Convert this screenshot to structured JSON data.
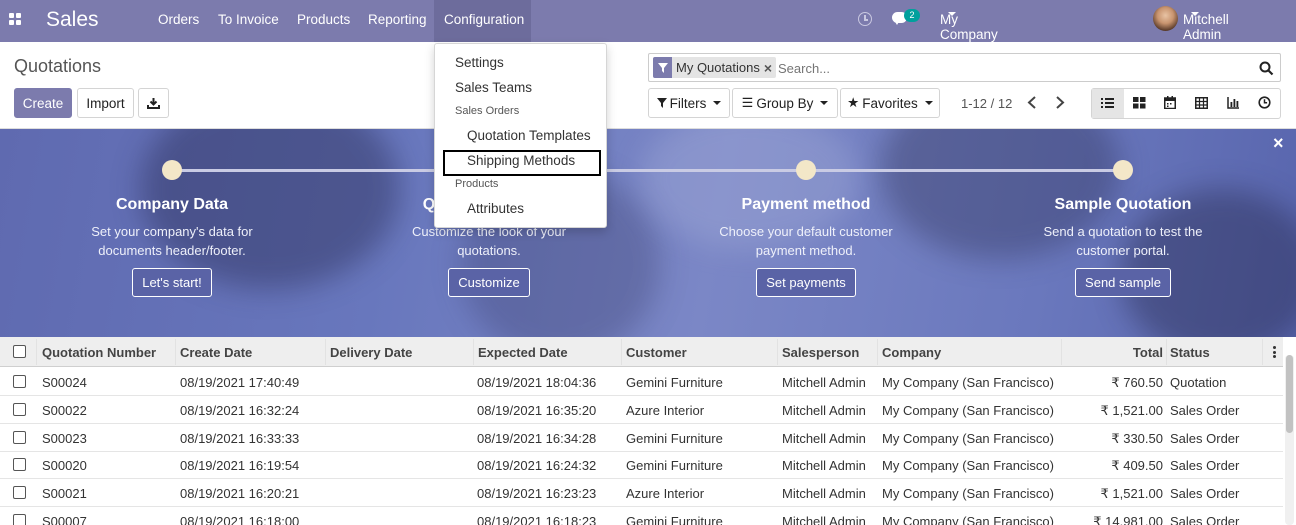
{
  "app": {
    "name": "Sales"
  },
  "menu": [
    "Orders",
    "To Invoice",
    "Products",
    "Reporting",
    "Configuration"
  ],
  "systray": {
    "message_count": "2",
    "company": "My Company (San Francisco)",
    "user": "Mitchell Admin"
  },
  "page": {
    "title": "Quotations",
    "create_label": "Create",
    "import_label": "Import"
  },
  "search": {
    "facet": "My Quotations",
    "placeholder": "Search..."
  },
  "toolbar": {
    "filters": "Filters",
    "group_by": "Group By",
    "favorites": "Favorites",
    "pager": "1-12 / 12"
  },
  "config_menu": {
    "items": [
      {
        "label": "Settings"
      },
      {
        "label": "Sales Teams"
      },
      {
        "label": "Sales Orders",
        "header": true
      },
      {
        "label": "Quotation Templates"
      },
      {
        "label": "Shipping Methods",
        "highlighted": true
      },
      {
        "label": "Products",
        "header": true
      },
      {
        "label": "Attributes"
      }
    ]
  },
  "onboarding": {
    "steps": [
      {
        "title": "Company Data",
        "desc1": "Set your company's data for",
        "desc2": "documents header/footer.",
        "button": "Let's start!"
      },
      {
        "title": "Quotation Layout",
        "desc1": "Customize the look of your",
        "desc2": "quotations.",
        "button": "Customize"
      },
      {
        "title": "Payment method",
        "desc1": "Choose your default customer",
        "desc2": "payment method.",
        "button": "Set payments"
      },
      {
        "title": "Sample Quotation",
        "desc1": "Send a quotation to test the",
        "desc2": "customer portal.",
        "button": "Send sample"
      }
    ],
    "close": "×"
  },
  "table": {
    "columns": [
      "Quotation Number",
      "Create Date",
      "Delivery Date",
      "Expected Date",
      "Customer",
      "Salesperson",
      "Company",
      "Total",
      "Status"
    ],
    "rows": [
      {
        "number": "S00024",
        "create": "08/19/2021 17:40:49",
        "delivery": "",
        "expected": "08/19/2021 18:04:36",
        "customer": "Gemini Furniture",
        "salesperson": "Mitchell Admin",
        "company": "My Company (San Francisco)",
        "total": "₹ 760.50",
        "status": "Quotation"
      },
      {
        "number": "S00022",
        "create": "08/19/2021 16:32:24",
        "delivery": "",
        "expected": "08/19/2021 16:35:20",
        "customer": "Azure Interior",
        "salesperson": "Mitchell Admin",
        "company": "My Company (San Francisco)",
        "total": "₹ 1,521.00",
        "status": "Sales Order"
      },
      {
        "number": "S00023",
        "create": "08/19/2021 16:33:33",
        "delivery": "",
        "expected": "08/19/2021 16:34:28",
        "customer": "Gemini Furniture",
        "salesperson": "Mitchell Admin",
        "company": "My Company (San Francisco)",
        "total": "₹ 330.50",
        "status": "Sales Order"
      },
      {
        "number": "S00020",
        "create": "08/19/2021 16:19:54",
        "delivery": "",
        "expected": "08/19/2021 16:24:32",
        "customer": "Gemini Furniture",
        "salesperson": "Mitchell Admin",
        "company": "My Company (San Francisco)",
        "total": "₹ 409.50",
        "status": "Sales Order"
      },
      {
        "number": "S00021",
        "create": "08/19/2021 16:20:21",
        "delivery": "",
        "expected": "08/19/2021 16:23:23",
        "customer": "Azure Interior",
        "salesperson": "Mitchell Admin",
        "company": "My Company (San Francisco)",
        "total": "₹ 1,521.00",
        "status": "Sales Order"
      },
      {
        "number": "S00007",
        "create": "08/19/2021 16:18:00",
        "delivery": "",
        "expected": "08/19/2021 16:18:23",
        "customer": "Gemini Furniture",
        "salesperson": "Mitchell Admin",
        "company": "My Company (San Francisco)",
        "total": "₹ 14,981.00",
        "status": "Sales Order"
      }
    ]
  },
  "colors": {
    "brand": "#7c7bad",
    "banner": "#6a76bb",
    "highlight_border": "#000000"
  },
  "icons": [
    "apps-grid-icon",
    "clock-icon",
    "chat-icon",
    "filter-icon",
    "search-icon",
    "download-icon",
    "list-view-icon",
    "kanban-view-icon",
    "calendar-view-icon",
    "pivot-view-icon",
    "graph-view-icon",
    "activity-view-icon",
    "close-icon",
    "kebab-icon"
  ]
}
